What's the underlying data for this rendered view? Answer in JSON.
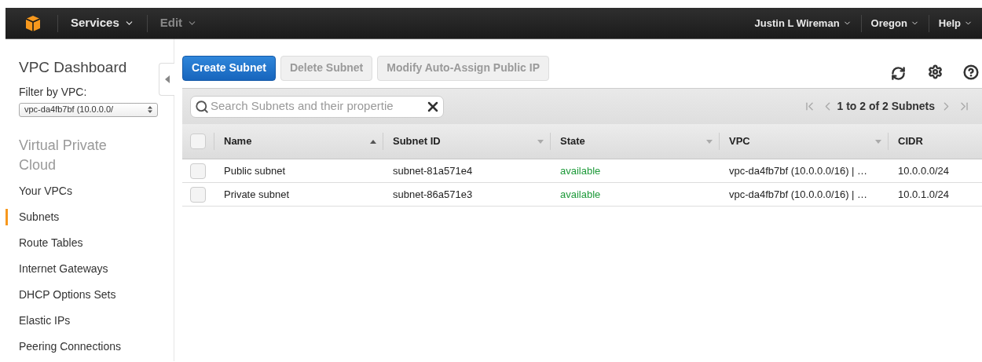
{
  "top_bar": {
    "menus": [
      {
        "label": "Services",
        "disabled": false
      },
      {
        "label": "Edit",
        "disabled": true
      }
    ],
    "right_menus": [
      "Justin L Wireman",
      "Oregon",
      "Help"
    ]
  },
  "sidebar": {
    "title": "VPC Dashboard",
    "filter_label": "Filter by VPC:",
    "filter_value": "vpc-da4fb7bf (10.0.0.0/",
    "section": "Virtual Private Cloud",
    "items": [
      {
        "label": "Your VPCs",
        "selected": false
      },
      {
        "label": "Subnets",
        "selected": true
      },
      {
        "label": "Route Tables",
        "selected": false
      },
      {
        "label": "Internet Gateways",
        "selected": false
      },
      {
        "label": "DHCP Options Sets",
        "selected": false
      },
      {
        "label": "Elastic IPs",
        "selected": false
      },
      {
        "label": "Peering Connections",
        "selected": false
      }
    ]
  },
  "toolbar": {
    "buttons": [
      {
        "label": "Create Subnet",
        "disabled": false
      },
      {
        "label": "Delete Subnet",
        "disabled": true
      },
      {
        "label": "Modify Auto-Assign Public IP",
        "disabled": true
      }
    ]
  },
  "search": {
    "placeholder": "Search Subnets and their propertie"
  },
  "pagination": "1 to 2 of 2 Subnets",
  "table": {
    "columns": [
      {
        "label": "Name",
        "sorted": true
      },
      {
        "label": "Subnet ID",
        "sorted": false
      },
      {
        "label": "State",
        "sorted": false
      },
      {
        "label": "VPC",
        "sorted": false
      },
      {
        "label": "CIDR"
      }
    ],
    "all_checked": false,
    "rows": [
      {
        "checked": false,
        "cells": [
          "Public subnet",
          "subnet-81a571e4",
          "available",
          "vpc-da4fb7bf (10.0.0.0/16) | …",
          "10.0.0.0/24"
        ]
      },
      {
        "checked": false,
        "cells": [
          "Private subnet",
          "subnet-86a571e3",
          "available",
          "vpc-da4fb7bf (10.0.0.0/16) | …",
          "10.0.1.0/24"
        ]
      }
    ]
  }
}
